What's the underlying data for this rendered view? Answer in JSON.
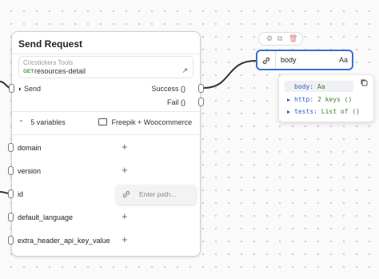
{
  "node": {
    "title": "Send Request",
    "endpoint": {
      "source": "Cricstickers Tools",
      "method": "GET",
      "name": "resources-detail",
      "open_icon": "arrow-up-right-icon"
    },
    "ports": {
      "input_label": "Send",
      "success_label": "Success",
      "success_type": "()",
      "fail_label": "Fail",
      "fail_type": "()"
    },
    "variables": {
      "summary": "5 variables",
      "account_label": "Freepik + Woocommerce",
      "items": [
        {
          "label": "domain"
        },
        {
          "label": "version"
        },
        {
          "label": "id"
        },
        {
          "label": "default_language"
        },
        {
          "label": "extra_header_api_key_value"
        }
      ]
    },
    "path_input": {
      "placeholder": "Enter path..."
    }
  },
  "body_node": {
    "label": "body",
    "type": "Aa",
    "popup": {
      "rows": [
        {
          "key": "body:",
          "value": "Aa"
        },
        {
          "key": "http:",
          "value": "2 keys ()"
        },
        {
          "key": "tests:",
          "value": "List of ()"
        }
      ]
    }
  },
  "colors": {
    "accent": "#3b6fd6",
    "method": "#2f9e44",
    "key": "#2c5fc0",
    "value": "#3a7d2e"
  }
}
